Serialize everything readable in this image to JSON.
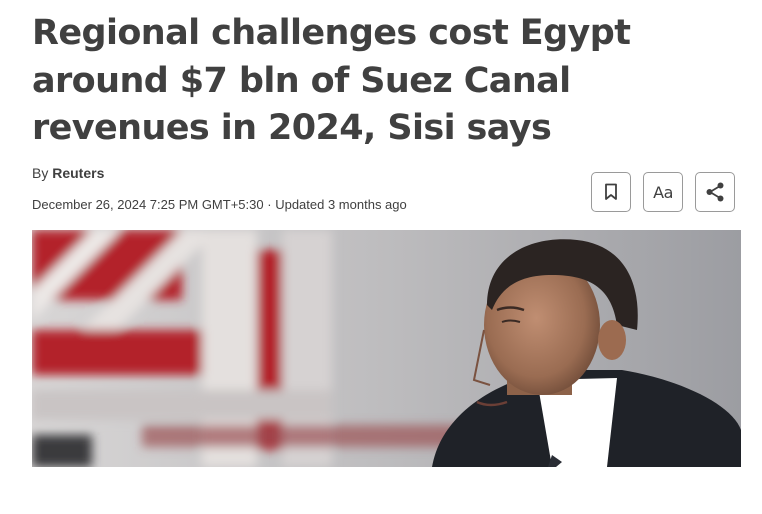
{
  "article": {
    "headline": "Regional challenges cost Egypt around $7 bln of Suez Canal revenues in 2024, Sisi says",
    "byline_prefix": "By",
    "author": "Reuters",
    "published": "December 26, 2024 7:25 PM GMT+5:30",
    "separator": "·",
    "updated": "Updated 3 months ago"
  },
  "toolbar": {
    "bookmark_icon": "bookmark-icon",
    "text_size_label": "Aa",
    "share_icon": "share-icon"
  },
  "colors": {
    "text": "#404040",
    "button_border": "#9a9a9a",
    "photo_red": "#b3232a"
  }
}
